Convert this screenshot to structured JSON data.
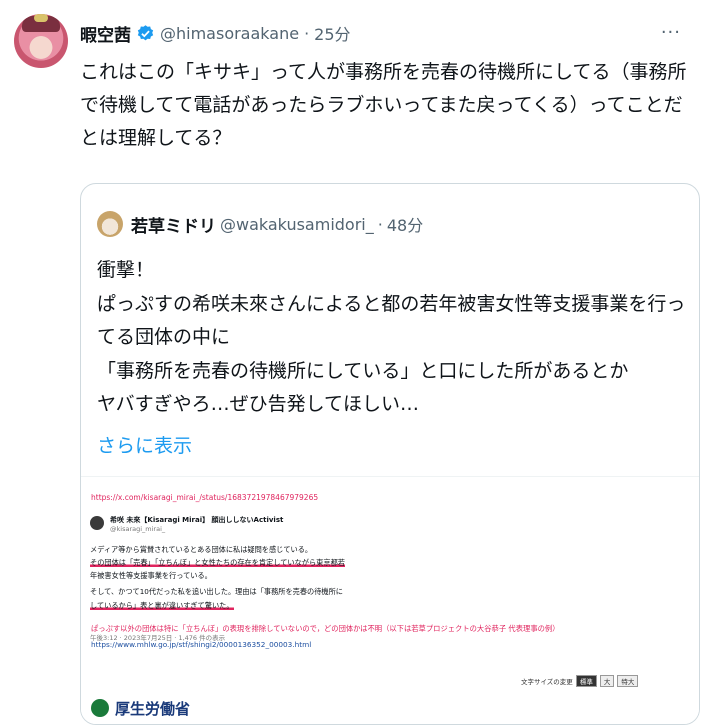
{
  "tweet": {
    "author_name": "暇空茜",
    "handle": "@himasoraakane",
    "separator": "·",
    "time": "25分",
    "more_label": "···",
    "text": "これはこの「キサキ」って人が事務所を売春の待機所にしてる（事務所で待機してて電話があったらラブホいってまた戻ってくる）ってことだとは理解してる？"
  },
  "quote": {
    "author_name": "若草ミドリ",
    "handle": "@wakakusamidori_",
    "separator": "·",
    "time": "48分",
    "lines": [
      "衝撃！",
      "ぱっぷすの希咲未來さんによると都の若年被害女性等支援事業を行ってる団体の中に",
      "「事務所を売春の待機所にしている」と口にした所があるとか",
      "ヤバすぎやろ…ぜひ告発してほしい…"
    ],
    "show_more": "さらに表示"
  },
  "embedded_image": {
    "url": "https://x.com/kisaragi_mirai_/status/1683721978467979265",
    "card_name": "希咲 未來【Kisaragi Mirai】 顔出ししないActivist",
    "card_handle": "@kisaragi_mirai_",
    "card_lines": [
      "メディア等から賞賛されているとある団体に私は疑問を感じている。",
      "その団体は「売春」「立ちんぼ」と女性たちの存在を肯定していながら東京都若",
      "年被害女性等支援事業を行っている。",
      "そして、かつて10代だった私を追い出した。理由は「事務所を売春の待機所に",
      "しているから」表と裏が違いすぎて驚いた。"
    ],
    "card_meta": "午後3:12 · 2023年7月25日 · 1,476 件の表示",
    "caption_red": "ぱっぷす以外の団体は特に「立ちんぼ」の表現を排除していないので，どの団体かは不明（以下は若草プロジェクトの大谷恭子 代表理事の例）",
    "caption_blue": "https://www.mhlw.go.jp/stf/shingi2/0000136352_00003.html",
    "font_size_label": "文字サイズの変更",
    "font_size_options": [
      "標準",
      "大",
      "特大"
    ],
    "logo_text": "厚生労働省"
  },
  "colors": {
    "link_blue": "#1d9bf0",
    "verified_blue": "#1d9bf0",
    "muted": "#536471",
    "accent_red": "#e0245e"
  }
}
